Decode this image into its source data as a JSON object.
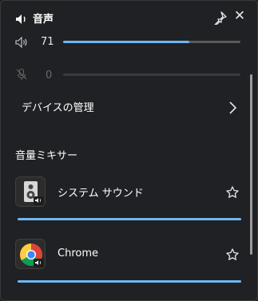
{
  "header": {
    "title": "音声",
    "speaker_icon": "speaker-icon",
    "pin_icon": "pin-icon",
    "close_glyph": "✕"
  },
  "output": {
    "volume": 71,
    "level_fraction": 0.71,
    "icon": "volume-icon"
  },
  "microphone": {
    "volume": 0,
    "level_fraction": 0.0,
    "icon": "microphone-muted-icon"
  },
  "manage_devices": {
    "label": "デバイスの管理",
    "icon": "chevron-right-icon"
  },
  "mixer": {
    "title": "音量ミキサー",
    "apps": [
      {
        "name": "システム サウンド",
        "icon": "system-sounds-icon",
        "level_fraction": 1.0
      },
      {
        "name": "Chrome",
        "icon": "chrome-icon",
        "level_fraction": 1.0
      }
    ]
  },
  "colors": {
    "accent": "#6fb6f2",
    "background": "#202124",
    "track": "#5a5a5a"
  }
}
